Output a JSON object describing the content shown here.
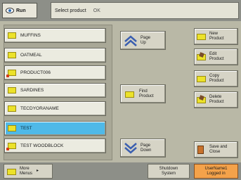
{
  "header": {
    "run_label": "Run",
    "title": "Select product",
    "status": "OK"
  },
  "products": [
    {
      "name": "MUFFINS",
      "locked": false
    },
    {
      "name": "OATMEAL",
      "locked": false
    },
    {
      "name": "PRODUCT006",
      "locked": true
    },
    {
      "name": "SARDINES",
      "locked": false
    },
    {
      "name": "TECDYORANAME",
      "locked": false
    },
    {
      "name": "TEST",
      "locked": false,
      "selected": true
    },
    {
      "name": "TEST WOODBLOCK",
      "locked": true
    }
  ],
  "middle": {
    "page_up": "Page\nUp",
    "find": "Find\nProduct",
    "page_down": "Page\nDown"
  },
  "right": {
    "new": "New\nProduct",
    "edit": "Edit\nProduct",
    "copy": "Copy\nProduct",
    "delete": "Delete\nProduct",
    "save": "Save and\nClose"
  },
  "footer": {
    "more": "More\nMenus",
    "shutdown": "Shutdown\nSystem",
    "user": "UserName1\nLogged in"
  },
  "colors": {
    "selected_row": "#4fb9e8",
    "user_badge": "#f4a24a",
    "folder": "#ece22a"
  }
}
